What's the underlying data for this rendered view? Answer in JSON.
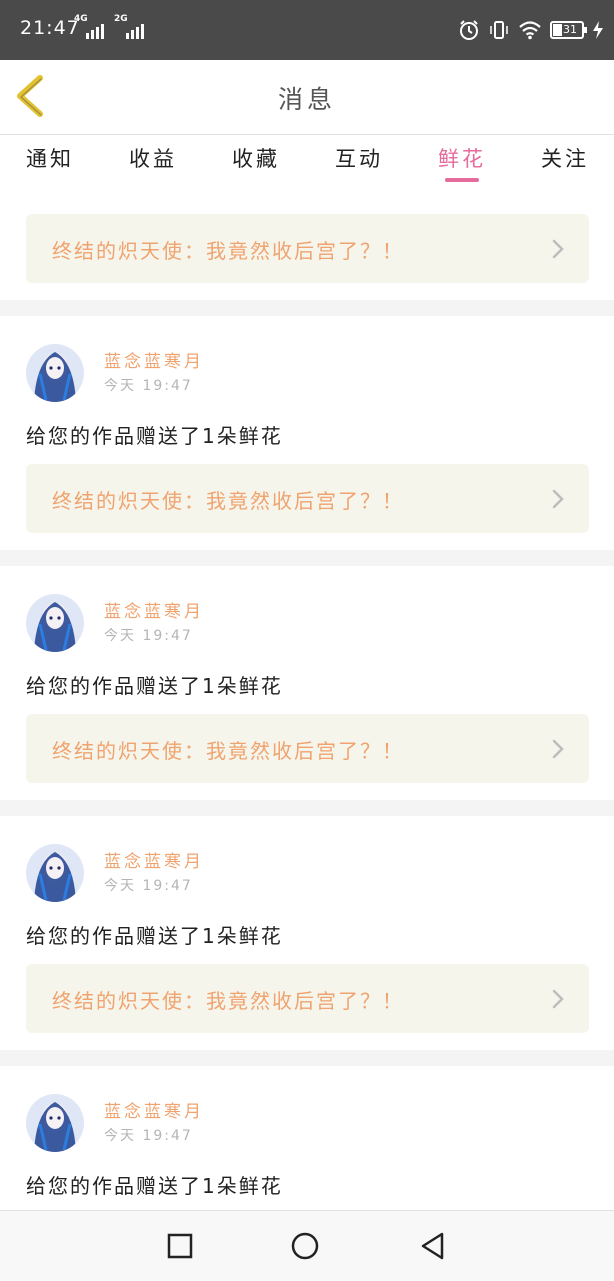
{
  "status_bar": {
    "time": "21:47",
    "net1": "4G",
    "net2": "2G",
    "battery": "31",
    "icons": [
      "signal-icon",
      "alarm-icon",
      "vibrate-icon",
      "wifi-icon",
      "battery-icon",
      "charging-icon"
    ]
  },
  "header": {
    "title": "消息",
    "back_icon": "chevron-left-icon"
  },
  "tabs": [
    {
      "label": "通知",
      "active": false
    },
    {
      "label": "收益",
      "active": false
    },
    {
      "label": "收藏",
      "active": false
    },
    {
      "label": "互动",
      "active": false
    },
    {
      "label": "鲜花",
      "active": true
    },
    {
      "label": "关注",
      "active": false
    }
  ],
  "feed": {
    "partial_top": {
      "work_title": "终结的炽天使：我竟然收后宫了？！"
    },
    "items": [
      {
        "username": "蓝念蓝寒月",
        "time": "今天 19:47",
        "message": "给您的作品赠送了1朵鲜花",
        "work_title": "终结的炽天使：我竟然收后宫了？！"
      },
      {
        "username": "蓝念蓝寒月",
        "time": "今天 19:47",
        "message": "给您的作品赠送了1朵鲜花",
        "work_title": "终结的炽天使：我竟然收后宫了？！"
      },
      {
        "username": "蓝念蓝寒月",
        "time": "今天 19:47",
        "message": "给您的作品赠送了1朵鲜花",
        "work_title": "终结的炽天使：我竟然收后宫了？！"
      },
      {
        "username": "蓝念蓝寒月",
        "time": "今天 19:47",
        "message": "给您的作品赠送了1朵鲜花"
      }
    ]
  },
  "colors": {
    "accent_pink": "#e56b9c",
    "username_orange": "#f0a36e",
    "card_bg": "#f6f5ec",
    "back_yellow": "#e2c22f"
  },
  "navbar": {
    "icons": [
      "recents-square-icon",
      "home-circle-icon",
      "back-triangle-icon"
    ]
  }
}
